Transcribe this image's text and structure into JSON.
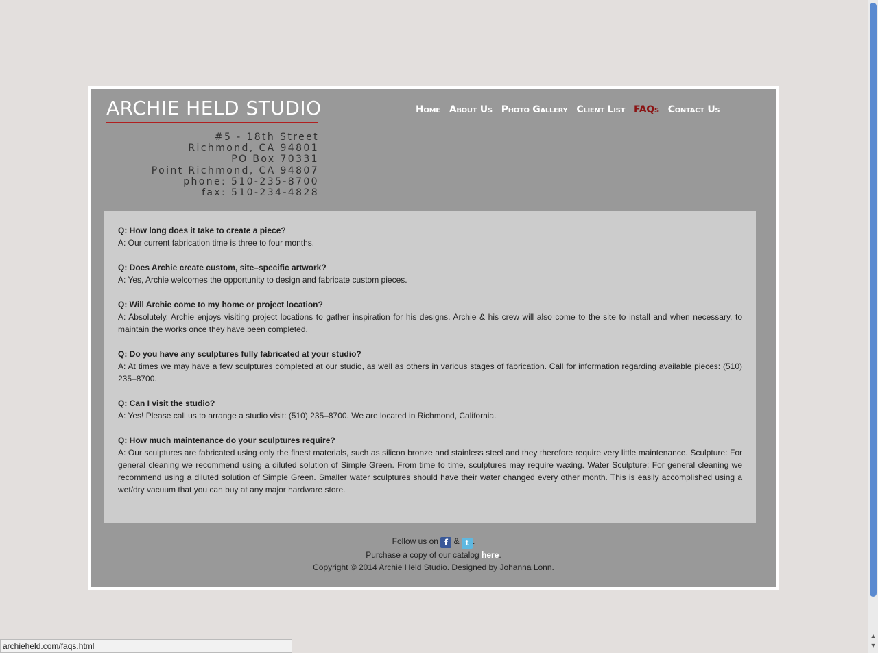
{
  "site": {
    "logo": "ARCHIE HELD STUDIO",
    "address_lines": [
      "#5 - 18th Street",
      "Richmond, CA 94801",
      "PO Box 70331",
      "Point Richmond, CA 94807",
      "phone: 510-235-8700",
      "fax: 510-234-4828"
    ]
  },
  "nav": [
    {
      "label": "Home",
      "active": false
    },
    {
      "label": "About Us",
      "active": false
    },
    {
      "label": "Photo Gallery",
      "active": false
    },
    {
      "label": "Client List",
      "active": false
    },
    {
      "label": "FAQs",
      "active": true
    },
    {
      "label": "Contact Us",
      "active": false
    }
  ],
  "faqs": [
    {
      "q": "Q: How long does it take to create a piece?",
      "a": "A: Our current fabrication time is three to four months."
    },
    {
      "q": "Q: Does Archie create custom, site–specific artwork?",
      "a": "A: Yes, Archie welcomes the opportunity to design and fabricate custom pieces."
    },
    {
      "q": "Q: Will Archie come to my home or project location?",
      "a": "A: Absolutely. Archie enjoys visiting project locations to gather inspiration for his designs. Archie & his crew will also come to the site to install and when necessary, to maintain the works once they have been completed."
    },
    {
      "q": "Q: Do you have any sculptures fully fabricated at your studio?",
      "a": "A: At times we may have a few sculptures completed at our studio, as well as others in various stages of fabrication. Call for information regarding available pieces: (510) 235–8700."
    },
    {
      "q": "Q: Can I visit the studio?",
      "a": "A: Yes! Please call us to arrange a studio visit: (510) 235–8700. We are located in Richmond, California."
    },
    {
      "q": "Q: How much maintenance do your sculptures require?",
      "a": "A: Our sculptures are fabricated using only the finest materials, such as silicon bronze and stainless steel and they therefore require very little maintenance. Sculpture: For general cleaning we recommend using a diluted solution of Simple Green. From time to time, sculptures may require waxing. Water Sculpture: For general cleaning we recommend using a diluted solution of Simple Green. Smaller water sculptures should have their water changed every other month. This is easily accomplished using a wet/dry vacuum that you can buy at any major hardware store."
    }
  ],
  "footer": {
    "follow_prefix": "Follow us on",
    "amp": "&",
    "period": ".",
    "facebook_glyph": "f",
    "twitter_glyph": "t",
    "catalog_prefix": "Purchase a copy of our catalog",
    "catalog_link": "here",
    "catalog_suffix": ".",
    "copyright": "Copyright © 2014 Archie Held Studio. Designed by Johanna Lonn."
  },
  "browser": {
    "status_url": "archieheld.com/faqs.html"
  },
  "colors": {
    "background": "#e3dfdd",
    "panel": "#999999",
    "content": "#cccccc",
    "accent": "#8b1414",
    "logo_rule": "#b02020"
  }
}
